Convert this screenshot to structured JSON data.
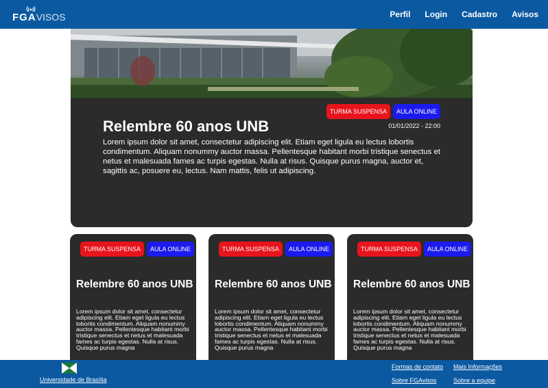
{
  "nav": {
    "logo_fg": "FG",
    "logo_a": "A",
    "logo_visos": "VISOS",
    "links": [
      "Perfil",
      "Login",
      "Cadastro",
      "Avisos"
    ]
  },
  "hero": {
    "badges": [
      "TURMA SUSPENSA",
      "AULA ONLINE"
    ],
    "date": "01/01/2022 - 22:00",
    "title": "Relembre 60 anos UNB",
    "text": "Lorem ipsum dolor sit amet, consectetur adipiscing elit. Etiam eget ligula eu lectus lobortis condimentum. Aliquam nonummy auctor massa. Pellentesque habitant morbi tristique senectus et netus et malesuada fames ac turpis egestas. Nulla at risus. Quisque purus magna, auctor et, sagittis ac, posuere eu, lectus. Nam mattis, felis ut adipiscing."
  },
  "cards": [
    {
      "badges": [
        "TURMA SUSPENSA",
        "AULA ONLINE"
      ],
      "title": "Relembre 60 anos UNB",
      "text": "Lorem ipsum dolor sit amet, consectetur adipiscing elit. Etiam eget ligula eu lectus lobortis condimentum. Aliquam nonummy auctor massa. Pellentesque habitant morbi tristique senectus et netus et malesuada fames ac turpis egestas. Nulla at risus. Quisque purus magna"
    },
    {
      "badges": [
        "TURMA SUSPENSA",
        "AULA ONLINE"
      ],
      "title": "Relembre 60 anos UNB",
      "text": "Lorem ipsum dolor sit amet, consectetur adipiscing elit. Etiam eget ligula eu lectus lobortis condimentum. Aliquam nonummy auctor massa. Pellentesque habitant morbi tristique senectus et netus et malesuada fames ac turpis egestas. Nulla at risus. Quisque purus magna"
    },
    {
      "badges": [
        "TURMA SUSPENSA",
        "AULA ONLINE"
      ],
      "title": "Relembre 60 anos UNB",
      "text": "Lorem ipsum dolor sit amet, consectetur adipiscing elit. Etiam eget ligula eu lectus lobortis condimentum. Aliquam nonummy auctor massa. Pellentesque habitant morbi tristique senectus et netus et malesuada fames ac turpis egestas. Nulla at risus. Quisque purus magna"
    }
  ],
  "footer": {
    "unb_label": "Universidade de Brasília",
    "links": [
      "Formas de contato",
      "Mais Informações",
      "Sobre FGAvisos",
      "Sobre a equipe"
    ]
  },
  "colors": {
    "brand_blue": "#0b59a1",
    "card_bg": "#2b2b2b",
    "badge_red": "#e8141b",
    "badge_blue": "#1b1bee"
  },
  "icons": [
    "signal-icon",
    "unb-flag-icon"
  ]
}
